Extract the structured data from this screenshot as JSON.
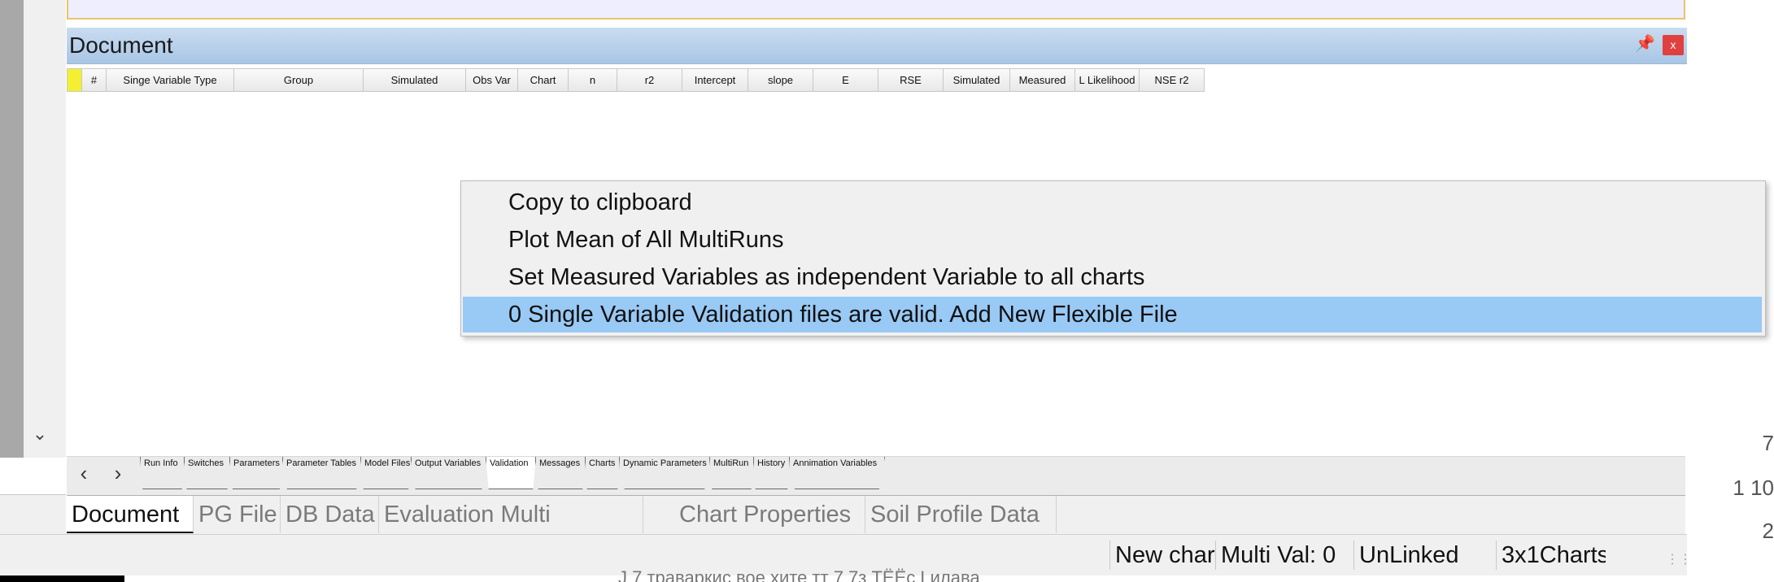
{
  "document": {
    "title": "Document",
    "pin_icon": "pin-icon",
    "close_icon": "close-icon",
    "close_label": "x"
  },
  "grid": {
    "columns": [
      "",
      "#",
      "Singe Variable Type",
      "Group",
      "Simulated",
      "Obs Var",
      "Chart",
      "n",
      "r2",
      "Intercept",
      "slope",
      "E",
      "RSE",
      "Simulated",
      "Measured",
      "L Likelihood",
      "NSE r2"
    ]
  },
  "context_menu": {
    "items": [
      "Copy to clipboard",
      "Plot Mean of All MultiRuns",
      "Set Measured Variables as independent Variable to all charts",
      "0 Single Variable Validation files are valid. Add New Flexible File"
    ],
    "highlighted_index": 3
  },
  "sheet_tabs": {
    "prev_icon": "chevron-left-icon",
    "next_icon": "chevron-right-icon",
    "items": [
      "Run Info",
      "Switches",
      "Parameters",
      "Parameter Tables",
      "Model Files",
      "Output Variables",
      "Validation",
      "Messages",
      "Charts",
      "Dynamic Parameters",
      "MultiRun",
      "History",
      "Annimation Variables"
    ],
    "active": "Validation"
  },
  "main_tabs": {
    "items": [
      "Document",
      "PG File",
      "DB Data",
      "Evaluation Multi",
      "Chart Properties",
      "Soil Profile Data"
    ],
    "active": "Document"
  },
  "status_bar": {
    "items": [
      "New chart",
      "Multi Val: 0",
      "UnLinked",
      "3x1Charts"
    ]
  },
  "background_text": {
    "right_numbers": [
      "7",
      "1 10",
      "2"
    ],
    "behind_row": "J 7 траваркис вое     xите тт 7 7з  ТЁЁс     Lилава"
  },
  "colors": {
    "header_gradient_top": "#c9dcf0",
    "menu_highlight": "#99c9f5",
    "row_selector": "#f4ef30",
    "close_button": "#e04040"
  }
}
